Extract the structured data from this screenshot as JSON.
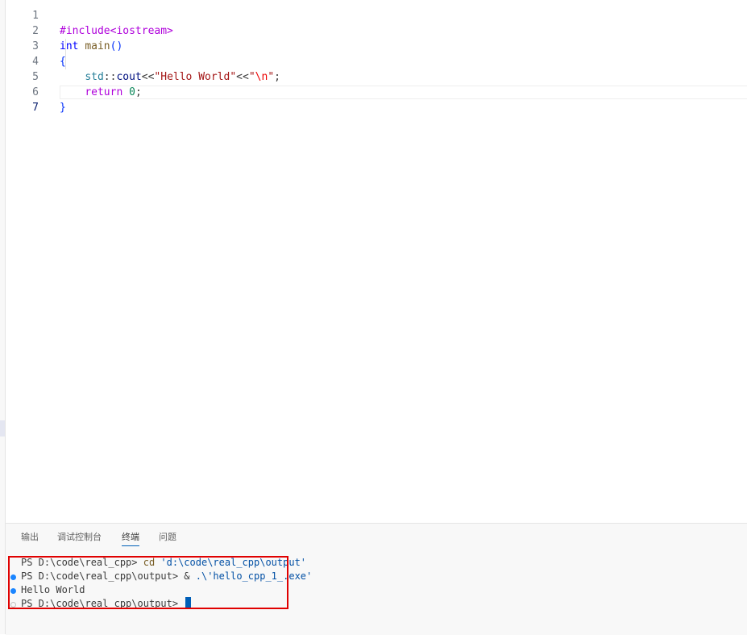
{
  "editor": {
    "lines": [
      {
        "num": "1",
        "tokens": [
          "#include<iostream>"
        ]
      },
      {
        "num": "2",
        "tokens": [
          "int",
          " ",
          "main",
          "()"
        ]
      },
      {
        "num": "3",
        "tokens": [
          "{"
        ]
      },
      {
        "num": "4",
        "tokens": [
          "    ",
          "std",
          "::",
          "cout",
          "<<",
          "\"Hello World\"",
          "<<",
          "\"",
          "\\n",
          "\"",
          ";"
        ]
      },
      {
        "num": "5",
        "tokens": [
          "    ",
          "return",
          " ",
          "0",
          ";"
        ]
      },
      {
        "num": "6",
        "tokens": [
          "}"
        ]
      },
      {
        "num": "7",
        "tokens": [
          ""
        ]
      }
    ]
  },
  "panel": {
    "tabs": [
      {
        "label": "输出"
      },
      {
        "label": "调试控制台"
      },
      {
        "label": "终端",
        "active": true
      },
      {
        "label": "问题"
      }
    ],
    "terminal": {
      "lines": [
        {
          "prompt": "PS D:\\code\\real_cpp> ",
          "cmd": "cd",
          "arg": " 'd:\\code\\real_cpp\\output'",
          "marker": "none"
        },
        {
          "prompt": "PS D:\\code\\real_cpp\\output> ",
          "cmd": "&",
          "arg": " .\\'hello_cpp_1_.exe'",
          "marker": "filled"
        },
        {
          "text": "Hello World",
          "marker": "filled"
        },
        {
          "prompt": "PS D:\\code\\real_cpp\\output> ",
          "marker": "hollow"
        }
      ]
    }
  },
  "colors": {
    "accent": "#005fb8",
    "highlight_box": "#e00000",
    "decorator_dot": "#1a85ff"
  }
}
